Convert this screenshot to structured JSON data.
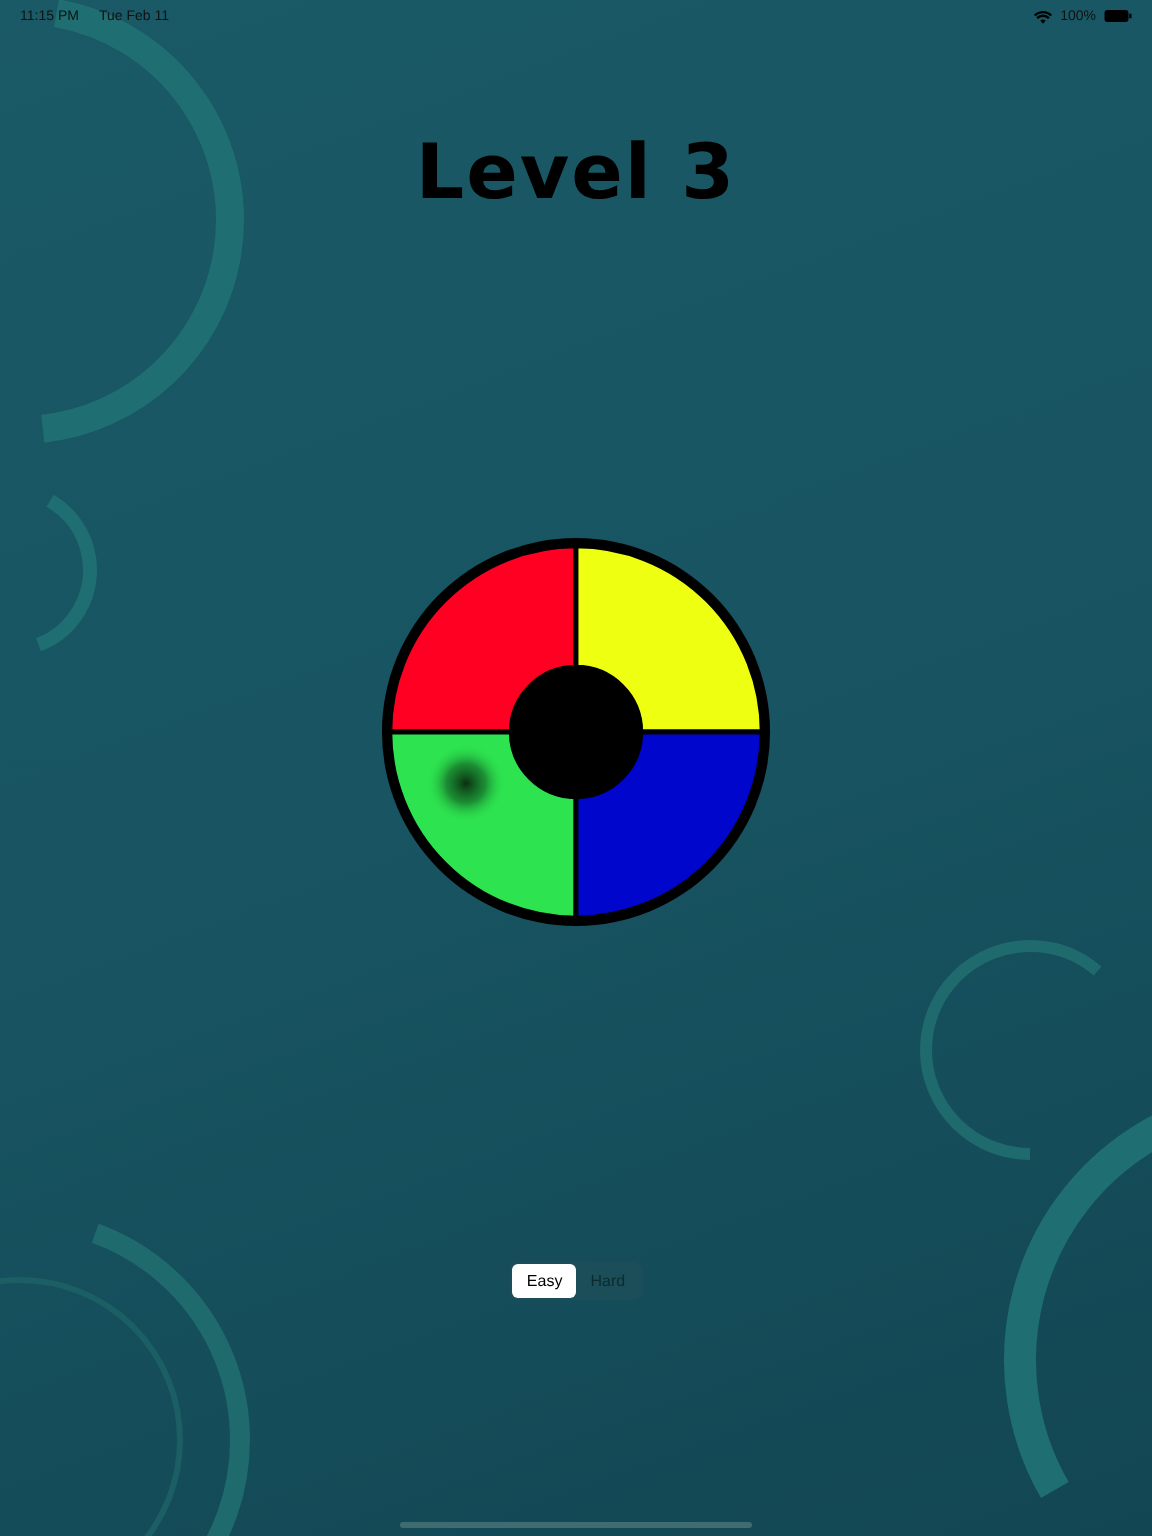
{
  "status_bar": {
    "time": "11:15 PM",
    "date": "Tue Feb 11",
    "battery": "100%"
  },
  "title": "Level 3",
  "wheel": {
    "quadrants": [
      {
        "color": "#ff0022",
        "pressed": false
      },
      {
        "color": "#eeff11",
        "pressed": false
      },
      {
        "color": "#2de34f",
        "pressed": true
      },
      {
        "color": "#0006cc",
        "pressed": false
      }
    ]
  },
  "difficulty": [
    {
      "label": "Easy",
      "selected": true
    },
    {
      "label": "Hard",
      "selected": false
    }
  ]
}
